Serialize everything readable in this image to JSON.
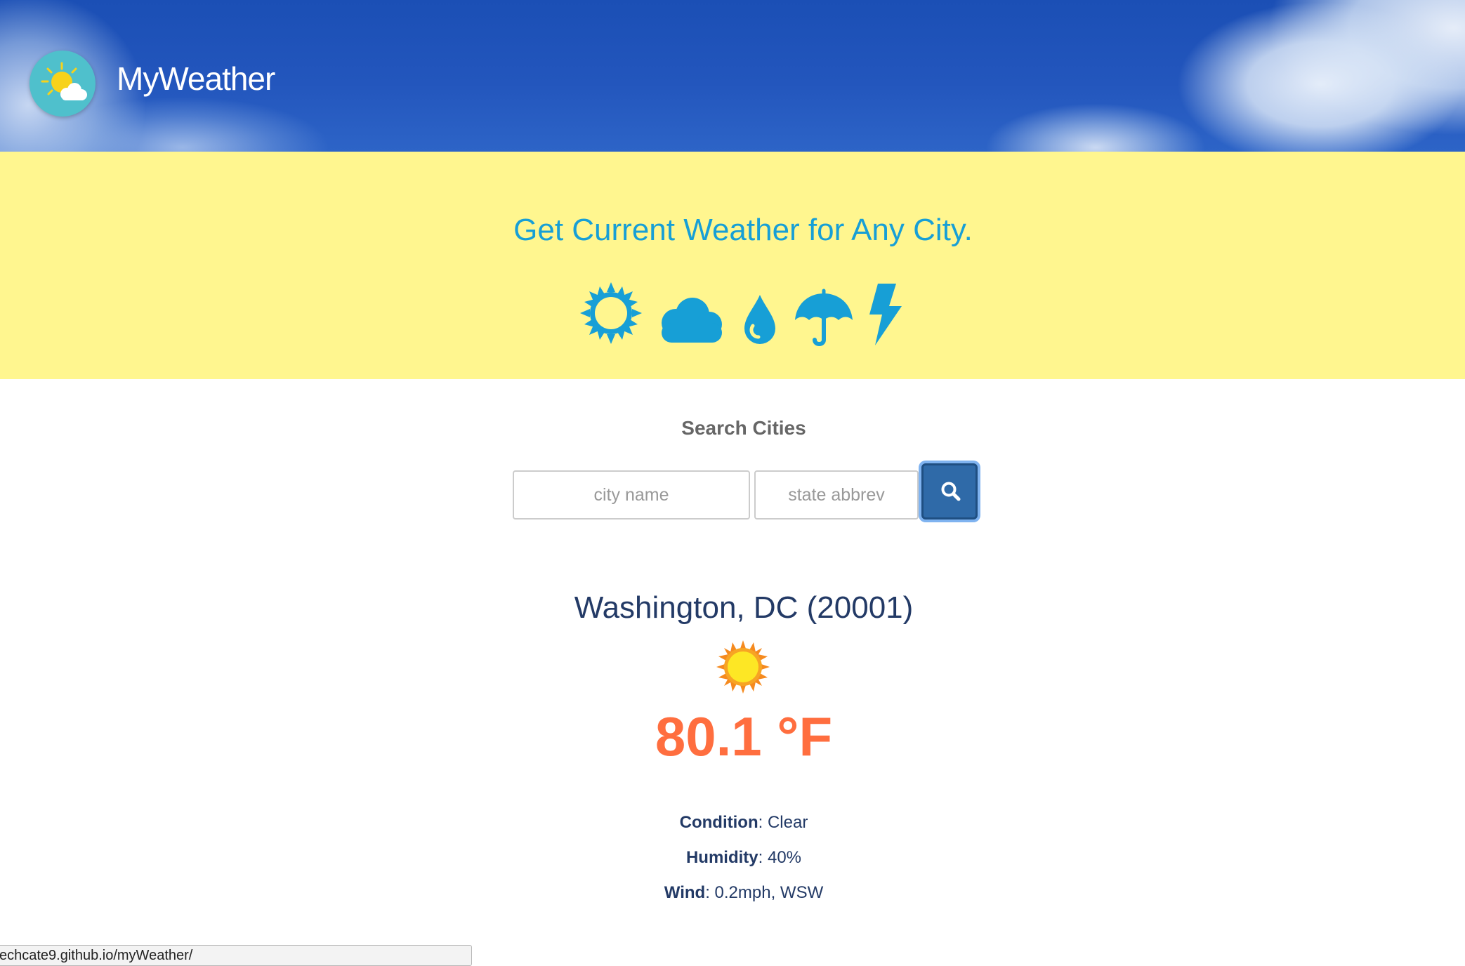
{
  "header": {
    "brand": "MyWeather",
    "logo_icon": "sun-behind-cloud-icon",
    "logo_color": "#4fc0cc"
  },
  "hero": {
    "title": "Get Current Weather for Any City.",
    "icons": [
      "sun-icon",
      "cloud-icon",
      "raindrop-icon",
      "umbrella-icon",
      "lightning-icon"
    ],
    "icon_color": "#179fd6",
    "background": "#fff68f"
  },
  "search": {
    "label": "Search Cities",
    "city_placeholder": "city name",
    "state_placeholder": "state abbrev",
    "button_icon": "search-icon",
    "button_color": "#2f6aa8"
  },
  "result": {
    "location": "Washington, DC (20001)",
    "condition_icon": "sunny-icon",
    "temperature": "80.1 °F",
    "details": [
      {
        "label": "Condition",
        "sep": ": ",
        "value": "Clear"
      },
      {
        "label": "Humidity",
        "sep": ": ",
        "value": "40%"
      },
      {
        "label": "Wind",
        "sep": ": ",
        "value": "0.2mph, WSW"
      }
    ]
  },
  "status_bar": {
    "text": "echcate9.github.io/myWeather/"
  }
}
